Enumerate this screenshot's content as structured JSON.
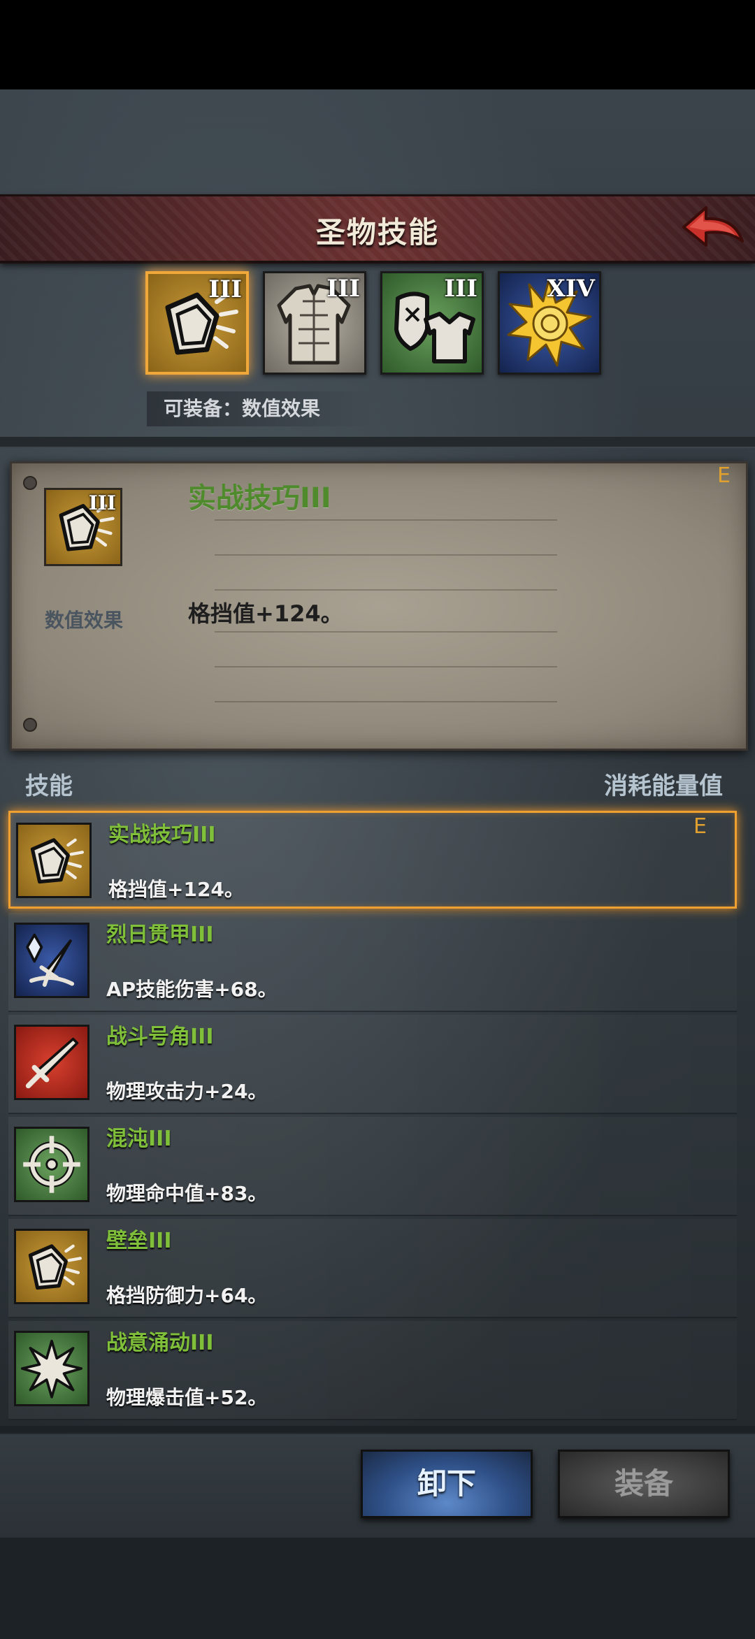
{
  "header": {
    "title": "圣物技能"
  },
  "relics": [
    {
      "level": "III",
      "selected": true
    },
    {
      "level": "III",
      "selected": false
    },
    {
      "level": "III",
      "selected": false
    },
    {
      "level": "XIV",
      "selected": false
    }
  ],
  "equip_label": "可装备：数值效果",
  "detail": {
    "level": "III",
    "category": "数值效果",
    "name": "实战技巧III",
    "effect": "格挡值+124。",
    "equipped_marker": "E"
  },
  "list": {
    "header_left": "技能",
    "header_right": "消耗能量值",
    "items": [
      {
        "name": "实战技巧III",
        "desc": "格挡值+124。",
        "marker": "E",
        "icon": "shield-icon"
      },
      {
        "name": "烈日贯甲III",
        "desc": "AP技能伤害+68。",
        "marker": "",
        "icon": "crystal-sword-icon"
      },
      {
        "name": "战斗号角III",
        "desc": "物理攻击力+24。",
        "marker": "",
        "icon": "sword-icon"
      },
      {
        "name": "混沌III",
        "desc": "物理命中值+83。",
        "marker": "",
        "icon": "crosshair-icon"
      },
      {
        "name": "壁垒III",
        "desc": "格挡防御力+64。",
        "marker": "",
        "icon": "shield-icon"
      },
      {
        "name": "战意涌动III",
        "desc": "物理爆击值+52。",
        "marker": "",
        "icon": "burst-icon"
      }
    ]
  },
  "buttons": {
    "unequip": "卸下",
    "equip": "装备"
  }
}
